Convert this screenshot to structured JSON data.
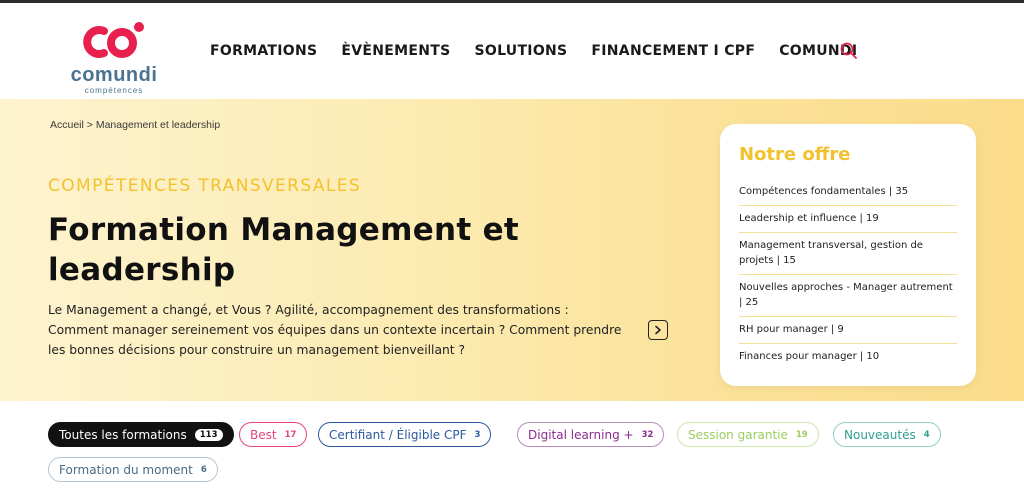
{
  "brand": {
    "name": "comundi",
    "tagline": "compétences",
    "accent_color": "#e8204e",
    "word_color": "#4a7490"
  },
  "nav": {
    "items": [
      {
        "label": "FORMATIONS"
      },
      {
        "label": "ÈVÈNEMENTS"
      },
      {
        "label": "SOLUTIONS"
      },
      {
        "label": "FINANCEMENT I CPF"
      },
      {
        "label": "COMUNDI"
      }
    ],
    "search_icon": "search-icon"
  },
  "hero": {
    "breadcrumb": {
      "home": "Accueil",
      "separator": ">",
      "current": "Management et leadership"
    },
    "eyebrow": "COMPÉTENCES TRANSVERSALES",
    "title": "Formation Management et leadership",
    "description": "Le Management a changé, et Vous ? Agilité, accompagnement des transformations : Comment manager sereinement vos équipes dans un contexte incertain ? Comment prendre les bonnes décisions pour construire un management bienveillant ?",
    "more_icon": "chevron-right-icon",
    "background_color": "#fbe29a"
  },
  "offer": {
    "title": "Notre offre",
    "title_color": "#f2c12e",
    "items": [
      {
        "label": "Compétences fondamentales | 35"
      },
      {
        "label": "Leadership et influence | 19"
      },
      {
        "label": "Management transversal, gestion de projets | 15"
      },
      {
        "label": "Nouvelles approches - Manager autrement | 25"
      },
      {
        "label": "RH pour manager | 9"
      },
      {
        "label": "Finances pour manager | 10"
      }
    ]
  },
  "filters": [
    {
      "label": "Toutes les formations",
      "count": "113",
      "color": "#111111",
      "active": true
    },
    {
      "label": "Best",
      "count": "17",
      "color": "#e8457a"
    },
    {
      "label": "Certifiant / Éligible CPF",
      "count": "3",
      "color": "#2c5aa0"
    },
    {
      "label": "Digital learning +",
      "count": "32",
      "color": "#8a2d8f"
    },
    {
      "label": "Session garantie",
      "count": "19",
      "color": "#9ccd5e"
    },
    {
      "label": "Nouveautés",
      "count": "4",
      "color": "#2f9e8f"
    },
    {
      "label": "Formation du moment",
      "count": "6",
      "color": "#4a6b85"
    }
  ]
}
